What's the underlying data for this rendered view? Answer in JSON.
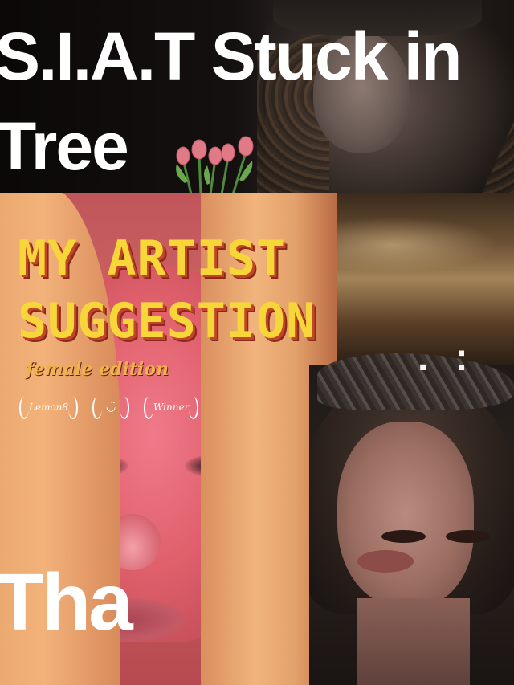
{
  "top_caption": {
    "line1": "S.I.A.T Stuck in",
    "line2": "Tree"
  },
  "title": {
    "line1": "MY ARTIST",
    "line2": "SUGGESTION"
  },
  "subtitle": "female edition",
  "badges": [
    {
      "label": "Lemon8"
    },
    {
      "label": "◡̈"
    },
    {
      "label": "Winner"
    }
  ],
  "decor_text": ". :",
  "bottom_caption": "Tha",
  "colors": {
    "title": "#f7d63a",
    "title_shadow": "#c2452a",
    "subtitle": "#f2b24a",
    "caption": "#ffffff"
  }
}
